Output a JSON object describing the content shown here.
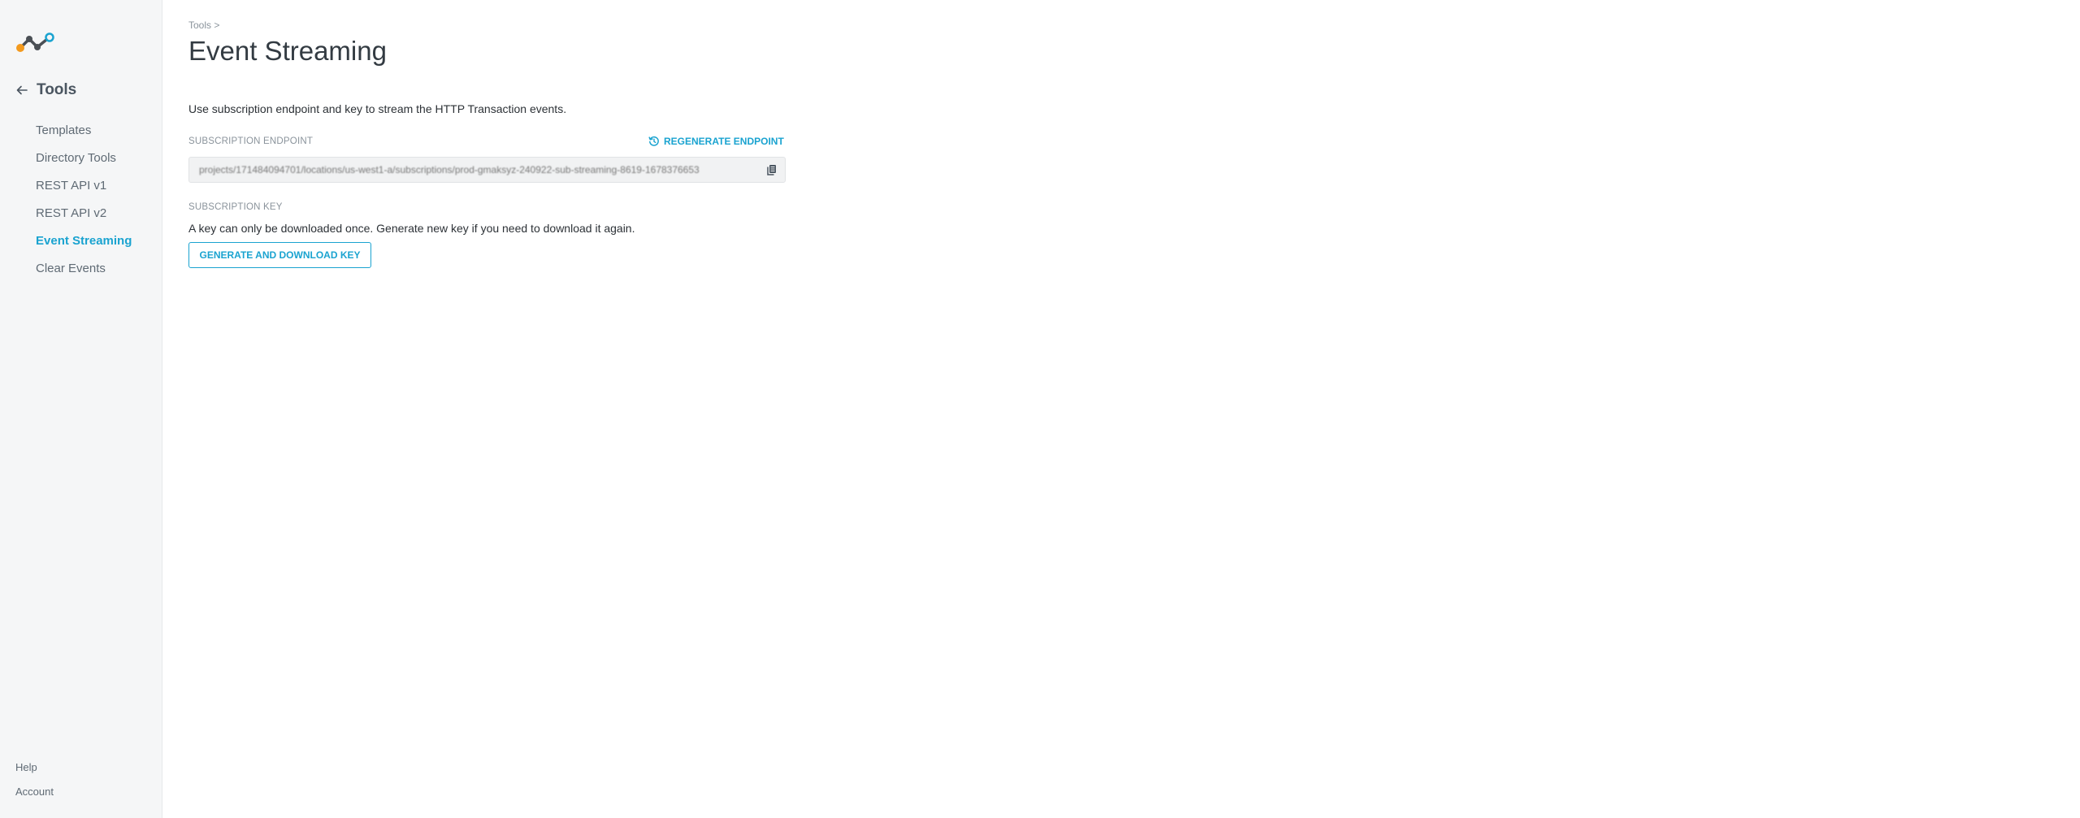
{
  "sidebar": {
    "section_title": "Tools",
    "items": [
      {
        "label": "Templates"
      },
      {
        "label": "Directory Tools"
      },
      {
        "label": "REST API v1"
      },
      {
        "label": "REST API v2"
      },
      {
        "label": "Event Streaming",
        "active": true
      },
      {
        "label": "Clear Events"
      }
    ],
    "bottom": {
      "help": "Help",
      "account": "Account"
    }
  },
  "header": {
    "breadcrumb": "Tools >",
    "title": "Event Streaming"
  },
  "content": {
    "intro": "Use subscription endpoint and key to stream the HTTP Transaction events.",
    "endpoint_label": "SUBSCRIPTION ENDPOINT",
    "regenerate_label": "REGENERATE ENDPOINT",
    "endpoint_value": "projects/171484094701/locations/us-west1-a/subscriptions/prod-gmaksyz-240922-sub-streaming-8619-1678376653",
    "key_label": "SUBSCRIPTION KEY",
    "key_help": "A key can only be downloaded once. Generate new key if you need to download it again.",
    "generate_button": "GENERATE AND DOWNLOAD KEY"
  },
  "colors": {
    "accent": "#1aa3d0",
    "logo_orange": "#f39a1e",
    "logo_dark": "#4a4f55"
  }
}
